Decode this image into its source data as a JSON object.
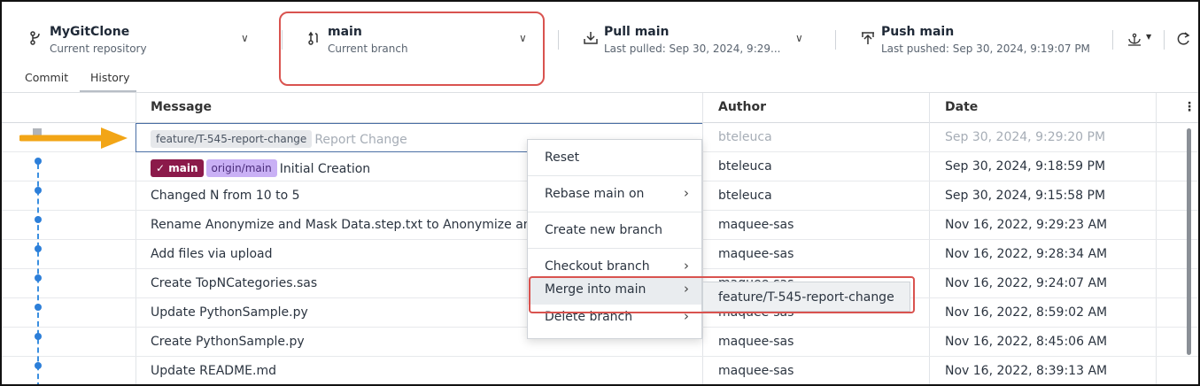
{
  "toolbar": {
    "repo": {
      "title": "MyGitClone",
      "subtitle": "Current repository"
    },
    "branch": {
      "title": "main",
      "subtitle": "Current branch"
    },
    "pull": {
      "title": "Pull main",
      "subtitle": "Last pulled: Sep 30, 2024, 9:29..."
    },
    "push": {
      "title": "Push main",
      "subtitle": "Last pushed: Sep 30, 2024, 9:19:07 PM"
    },
    "icons": [
      "repo-branch-icon",
      "branch-icon",
      "pull-icon",
      "push-icon",
      "fork-options-icon",
      "refresh-icon"
    ],
    "highlight_color": "#d9534f"
  },
  "tabs": [
    {
      "label": "Commit"
    },
    {
      "label": "History",
      "selected": true
    }
  ],
  "table": {
    "headers": {
      "message": "Message",
      "author": "Author",
      "date": "Date"
    },
    "rows": [
      {
        "tags": [
          "feature/T-545-report-change"
        ],
        "message": "Report Change",
        "author": "bteleuca",
        "date": "Sep 30, 2024, 9:29:20 PM",
        "faded": true
      },
      {
        "tags": [
          "main",
          "origin/main"
        ],
        "message": "Initial Creation",
        "author": "bteleuca",
        "date": "Sep 30, 2024, 9:18:59 PM"
      },
      {
        "message": "Changed N from 10 to 5",
        "author": "bteleuca",
        "date": "Sep 30, 2024, 9:15:58 PM"
      },
      {
        "message": "Rename Anonymize and Mask Data.step.txt to Anonymize an",
        "author": "maquee-sas",
        "date": "Nov 16, 2022, 9:29:23 AM"
      },
      {
        "message": "Add files via upload",
        "author": "maquee-sas",
        "date": "Nov 16, 2022, 9:28:34 AM"
      },
      {
        "message": "Create TopNCategories.sas",
        "author": "maquee-sas",
        "date": "Nov 16, 2022, 9:24:07 AM"
      },
      {
        "message": "Update PythonSample.py",
        "author": "maquee-sas",
        "date": "Nov 16, 2022, 8:59:02 AM"
      },
      {
        "message": "Create PythonSample.py",
        "author": "maquee-sas",
        "date": "Nov 16, 2022, 8:45:06 AM"
      },
      {
        "message": "Update README.md",
        "author": "maquee-sas",
        "date": "Nov 16, 2022, 8:39:13 AM"
      }
    ]
  },
  "main_tag": {
    "check": "✓",
    "label": "main"
  },
  "context_menu": {
    "items": [
      {
        "label": "Reset"
      },
      {
        "label": "Rebase main on",
        "submenu": true
      },
      {
        "label": "Create new branch"
      },
      {
        "label": "Checkout branch",
        "submenu": true
      },
      {
        "label": "Merge into main",
        "submenu": true,
        "highlighted": true
      },
      {
        "label": "Delete branch",
        "submenu": true
      }
    ],
    "submenu": {
      "label": "feature/T-545-report-change"
    }
  },
  "colors": {
    "main_tag": "#8b1a4a",
    "origin_tag": "#c9b0f5",
    "graph": "#2d7fd9",
    "arrow": "#f2a516"
  }
}
